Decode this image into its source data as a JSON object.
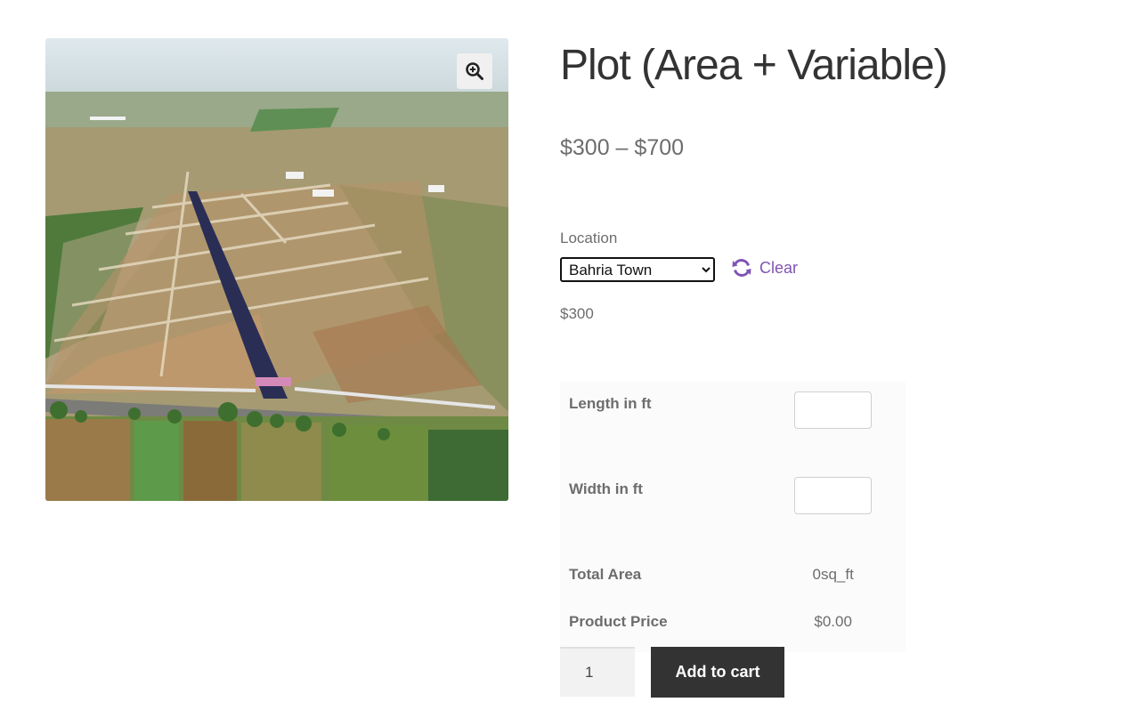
{
  "product": {
    "title": "Plot (Area + Variable)",
    "price_range": "$300 – $700"
  },
  "gallery": {
    "zoom_icon": "magnifier-plus-icon"
  },
  "variation": {
    "location_label": "Location",
    "location_selected": "Bahria Town",
    "clear_label": "Clear",
    "clear_icon": "refresh-icon",
    "variation_price": "$300"
  },
  "calculator": {
    "length_label": "Length in ft",
    "width_label": "Width in ft",
    "total_area_label": "Total Area",
    "total_area_value": "0sq_ft",
    "product_price_label": "Product Price",
    "product_price_value": "$0.00"
  },
  "cart": {
    "quantity": "1",
    "add_to_cart_label": "Add to cart"
  },
  "colors": {
    "link": "#7f54b3",
    "button_bg": "#333333"
  }
}
